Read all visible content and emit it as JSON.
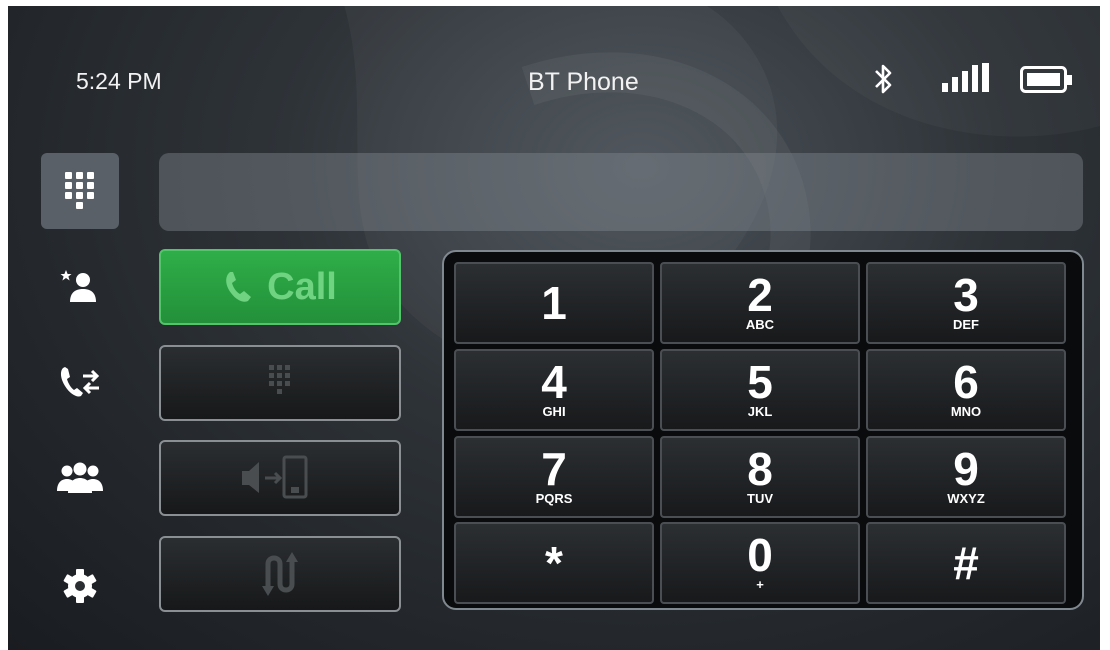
{
  "status_bar": {
    "time": "5:24 PM",
    "title": "BT Phone",
    "icons": [
      "bluetooth-icon",
      "signal-strength-icon",
      "battery-icon"
    ]
  },
  "sidebar": {
    "items": [
      {
        "name": "keypad",
        "icon": "dialpad-icon",
        "active": true
      },
      {
        "name": "favorites",
        "icon": "favorite-contact-icon",
        "active": false
      },
      {
        "name": "recent-calls",
        "icon": "call-history-icon",
        "active": false
      },
      {
        "name": "contacts",
        "icon": "contacts-icon",
        "active": false
      },
      {
        "name": "settings",
        "icon": "gear-icon",
        "active": false
      }
    ]
  },
  "number_display": {
    "value": ""
  },
  "actions": {
    "call_label": "Call",
    "buttons": [
      "phone-icon",
      "dtmf-keypad-icon",
      "audio-transfer-icon",
      "swap-call-icon"
    ]
  },
  "keypad": {
    "keys": [
      {
        "digit": "1",
        "letters": ""
      },
      {
        "digit": "2",
        "letters": "ABC"
      },
      {
        "digit": "3",
        "letters": "DEF"
      },
      {
        "digit": "4",
        "letters": "GHI"
      },
      {
        "digit": "5",
        "letters": "JKL"
      },
      {
        "digit": "6",
        "letters": "MNO"
      },
      {
        "digit": "7",
        "letters": "PQRS"
      },
      {
        "digit": "8",
        "letters": "TUV"
      },
      {
        "digit": "9",
        "letters": "WXYZ"
      },
      {
        "digit": "*",
        "letters": ""
      },
      {
        "digit": "0",
        "letters": "+"
      },
      {
        "digit": "#",
        "letters": ""
      }
    ]
  },
  "colors": {
    "call_green": "#2fae48",
    "call_label": "#6fd381",
    "active_nav": "#5a6068"
  }
}
